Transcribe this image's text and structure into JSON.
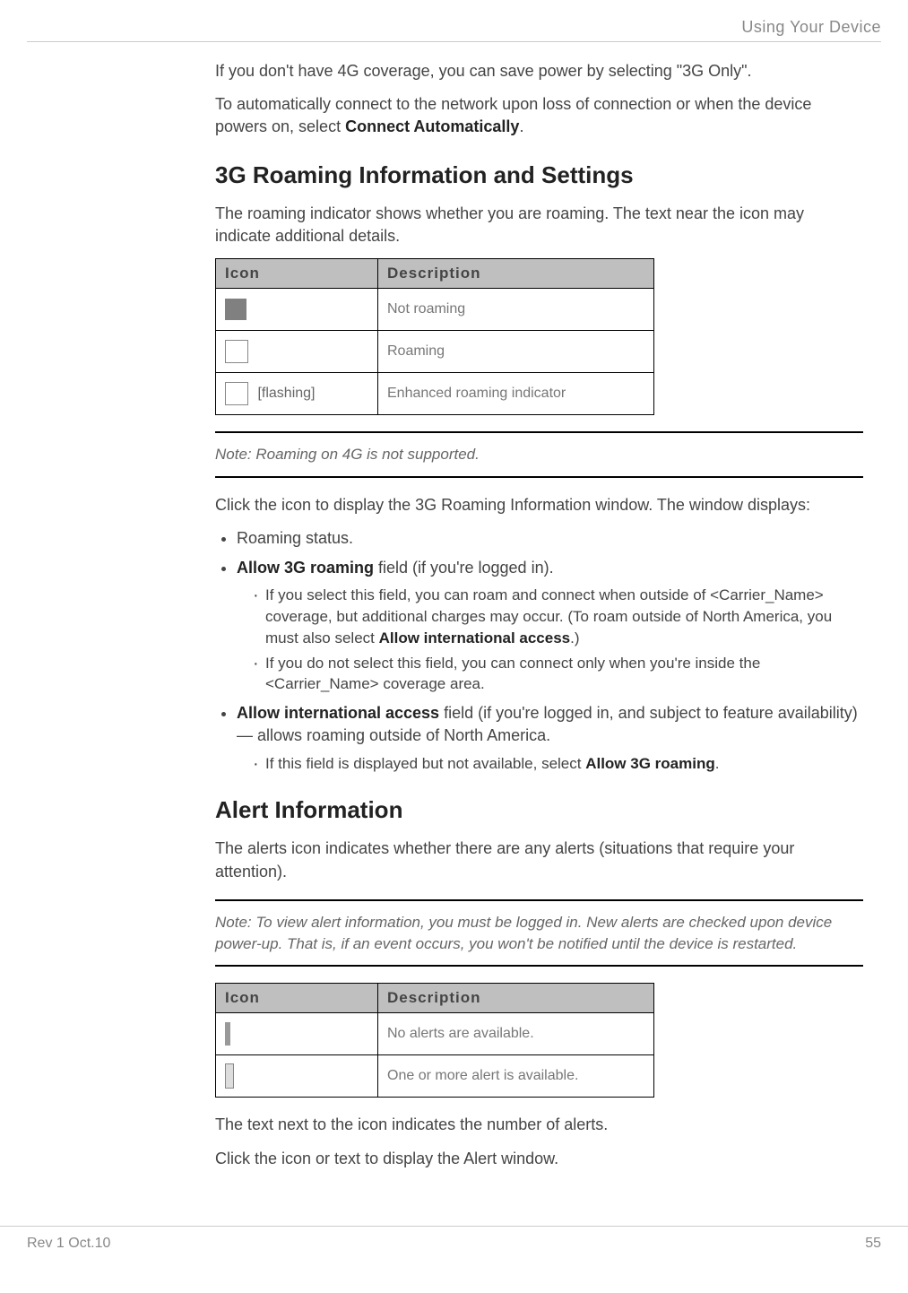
{
  "header": {
    "section": "Using Your Device"
  },
  "intro": {
    "p1": "If you don't have 4G coverage, you can save power by selecting \"3G Only\".",
    "p2a": "To automatically connect to the network upon loss of connection or when the device powers on, select ",
    "p2b": "Connect Automatically",
    "p2c": "."
  },
  "roaming": {
    "heading": "3G Roaming Information and Settings",
    "p1": "The roaming indicator shows whether you are roaming. The text near the icon may indicate additional details.",
    "table": {
      "h1": "Icon",
      "h2": "Description",
      "rows": [
        {
          "icon_label": "",
          "desc": "Not roaming"
        },
        {
          "icon_label": "",
          "desc": "Roaming"
        },
        {
          "icon_label": "[flashing]",
          "desc": "Enhanced roaming indicator"
        }
      ]
    },
    "note": "Note:  Roaming on 4G is not supported.",
    "p2": "Click the icon to display the 3G Roaming Information window. The window displays:",
    "bullets": {
      "b1": "Roaming status.",
      "b2a": "Allow 3G roaming",
      "b2b": " field (if you're logged in).",
      "b2_s1a": "If you select this field, you can roam and connect when outside of <Carrier_Name> coverage, but additional charges may occur. (To roam outside of North America, you must also select ",
      "b2_s1b": "Allow international access",
      "b2_s1c": ".)",
      "b2_s2": "If you do not select this field, you can connect only when you're inside the <Carrier_Name> coverage area.",
      "b3a": "Allow international access",
      "b3b": " field (if you're logged in, and subject to feature avail­ability) — allows roaming outside of North America.",
      "b3_s1a": "If this field is displayed but not available, select ",
      "b3_s1b": "Allow 3G roaming",
      "b3_s1c": "."
    }
  },
  "alerts": {
    "heading": "Alert Information",
    "p1": "The alerts icon indicates whether there are any alerts (situations that require your attention).",
    "note": "Note:  To view alert information, you must be logged in. New alerts are checked upon device power-up. That is, if an event occurs, you won't be notified until the device is restarted.",
    "table": {
      "h1": "Icon",
      "h2": "Description",
      "rows": [
        {
          "desc": "No alerts are available."
        },
        {
          "desc": "One or more alert is available."
        }
      ]
    },
    "p2": "The text next to the icon indicates the number of alerts.",
    "p3": "Click the icon or text to display the Alert window."
  },
  "footer": {
    "left": "Rev 1  Oct.10",
    "right": "55"
  }
}
